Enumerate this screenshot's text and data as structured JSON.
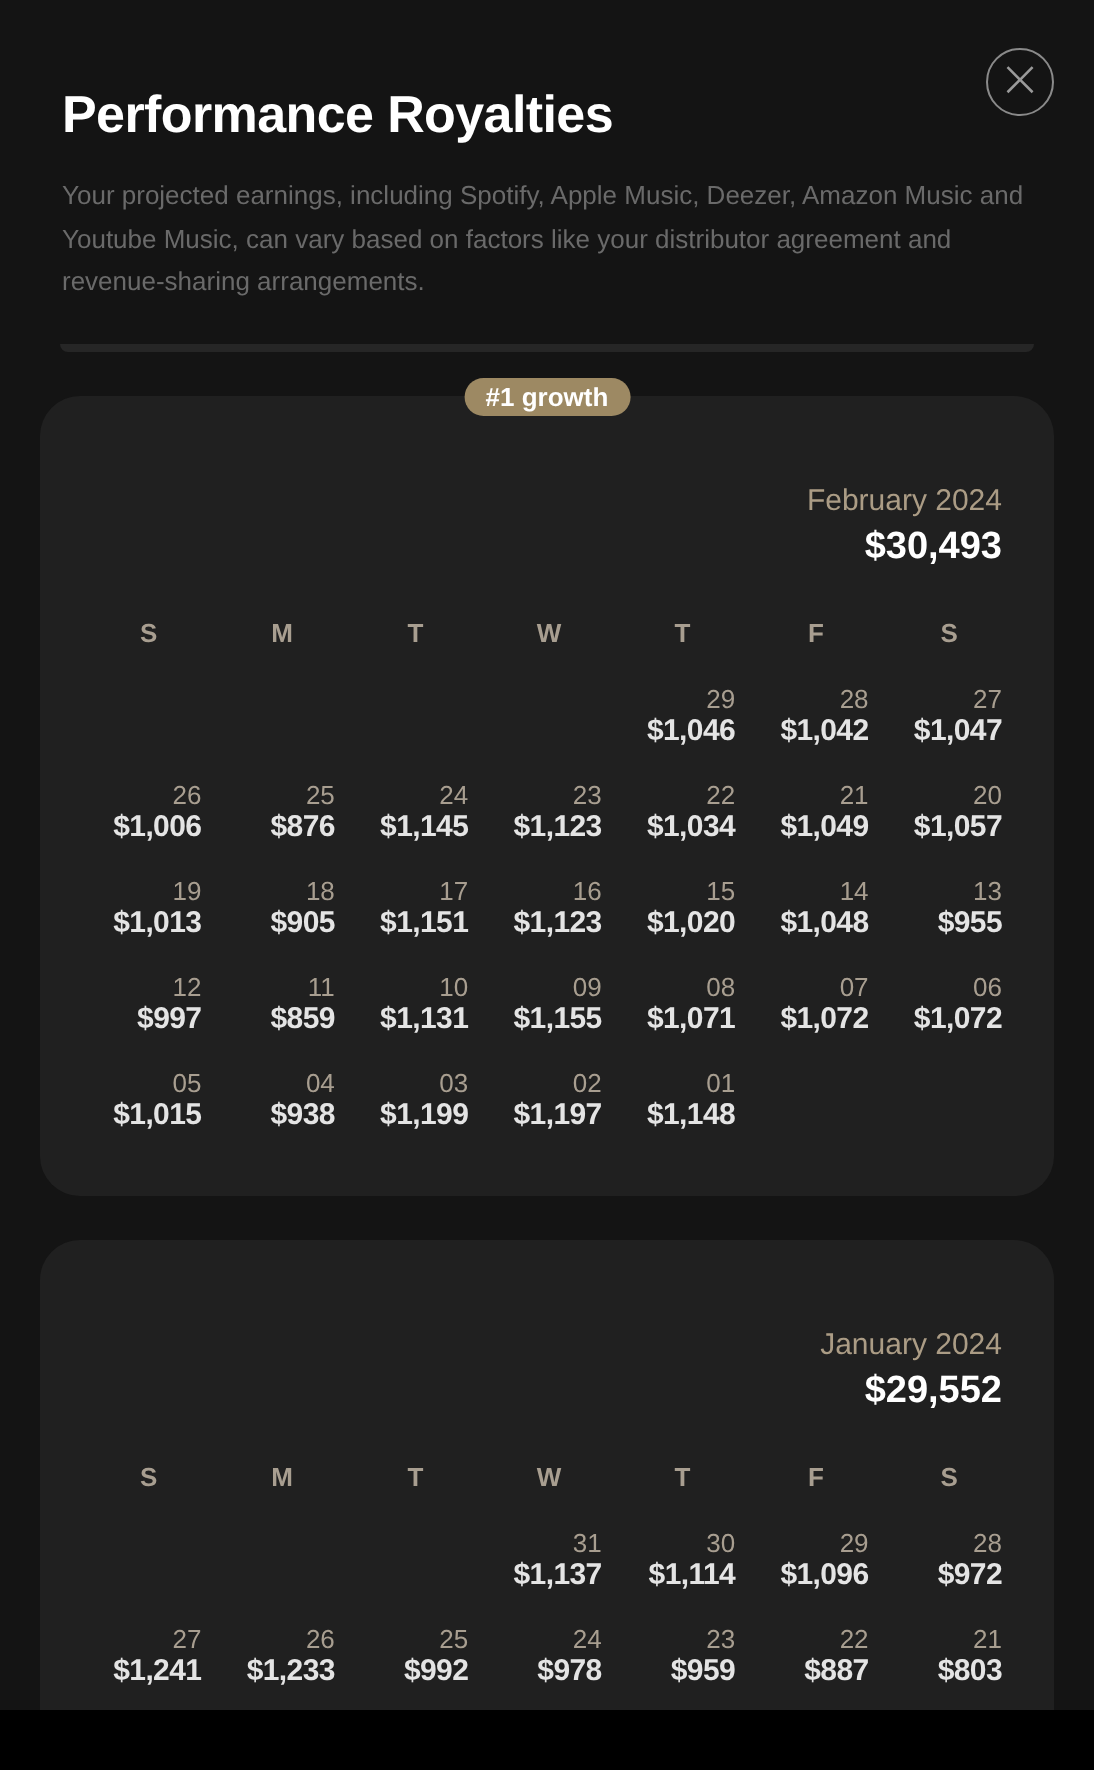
{
  "title": "Performance Royalties",
  "description": "Your projected earnings, including Spotify, Apple Music, Deezer, Amazon Music and Youtube Music, can vary based on factors like your distributor agreement and revenue-sharing arrangements.",
  "close_button": {
    "label": "×"
  },
  "months": [
    {
      "badge": "#1 growth",
      "month": "February 2024",
      "total": "$30,493",
      "weekdays": [
        "S",
        "M",
        "T",
        "W",
        "T",
        "F",
        "S"
      ],
      "weeks": [
        [
          {
            "kind": "blank"
          },
          {
            "kind": "blank"
          },
          {
            "kind": "blank"
          },
          {
            "kind": "blank"
          },
          {
            "kind": "day",
            "day": "29",
            "amount": "$1,046"
          },
          {
            "kind": "day",
            "day": "28",
            "amount": "$1,042"
          },
          {
            "kind": "day",
            "day": "27",
            "amount": "$1,047"
          }
        ],
        [
          {
            "kind": "day",
            "day": "26",
            "amount": "$1,006"
          },
          {
            "kind": "day",
            "day": "25",
            "amount": "$876"
          },
          {
            "kind": "day",
            "day": "24",
            "amount": "$1,145"
          },
          {
            "kind": "day",
            "day": "23",
            "amount": "$1,123"
          },
          {
            "kind": "day",
            "day": "22",
            "amount": "$1,034"
          },
          {
            "kind": "day",
            "day": "21",
            "amount": "$1,049"
          },
          {
            "kind": "day",
            "day": "20",
            "amount": "$1,057"
          }
        ],
        [
          {
            "kind": "day",
            "day": "19",
            "amount": "$1,013"
          },
          {
            "kind": "day",
            "day": "18",
            "amount": "$905"
          },
          {
            "kind": "day",
            "day": "17",
            "amount": "$1,151"
          },
          {
            "kind": "day",
            "day": "16",
            "amount": "$1,123"
          },
          {
            "kind": "day",
            "day": "15",
            "amount": "$1,020"
          },
          {
            "kind": "day",
            "day": "14",
            "amount": "$1,048"
          },
          {
            "kind": "day",
            "day": "13",
            "amount": "$955"
          }
        ],
        [
          {
            "kind": "day",
            "day": "12",
            "amount": "$997"
          },
          {
            "kind": "day",
            "day": "11",
            "amount": "$859"
          },
          {
            "kind": "day",
            "day": "10",
            "amount": "$1,131"
          },
          {
            "kind": "day",
            "day": "09",
            "amount": "$1,155"
          },
          {
            "kind": "day",
            "day": "08",
            "amount": "$1,071"
          },
          {
            "kind": "day",
            "day": "07",
            "amount": "$1,072"
          },
          {
            "kind": "day",
            "day": "06",
            "amount": "$1,072"
          }
        ],
        [
          {
            "kind": "day",
            "day": "05",
            "amount": "$1,015"
          },
          {
            "kind": "day",
            "day": "04",
            "amount": "$938"
          },
          {
            "kind": "day",
            "day": "03",
            "amount": "$1,199"
          },
          {
            "kind": "day",
            "day": "02",
            "amount": "$1,197"
          },
          {
            "kind": "day",
            "day": "01",
            "amount": "$1,148"
          },
          {
            "kind": "blank"
          },
          {
            "kind": "blank"
          }
        ]
      ]
    },
    {
      "month": "January 2024",
      "total": "$29,552",
      "weekdays": [
        "S",
        "M",
        "T",
        "W",
        "T",
        "F",
        "S"
      ],
      "weeks": [
        [
          {
            "kind": "blank"
          },
          {
            "kind": "blank"
          },
          {
            "kind": "blank"
          },
          {
            "kind": "day",
            "day": "31",
            "amount": "$1,137"
          },
          {
            "kind": "day",
            "day": "30",
            "amount": "$1,114"
          },
          {
            "kind": "day",
            "day": "29",
            "amount": "$1,096"
          },
          {
            "kind": "day",
            "day": "28",
            "amount": "$972"
          }
        ],
        [
          {
            "kind": "day",
            "day": "27",
            "amount": "$1,241"
          },
          {
            "kind": "day",
            "day": "26",
            "amount": "$1,233"
          },
          {
            "kind": "day",
            "day": "25",
            "amount": "$992"
          },
          {
            "kind": "day",
            "day": "24",
            "amount": "$978"
          },
          {
            "kind": "day",
            "day": "23",
            "amount": "$959"
          },
          {
            "kind": "day",
            "day": "22",
            "amount": "$887"
          },
          {
            "kind": "day",
            "day": "21",
            "amount": "$803"
          }
        ]
      ]
    }
  ]
}
